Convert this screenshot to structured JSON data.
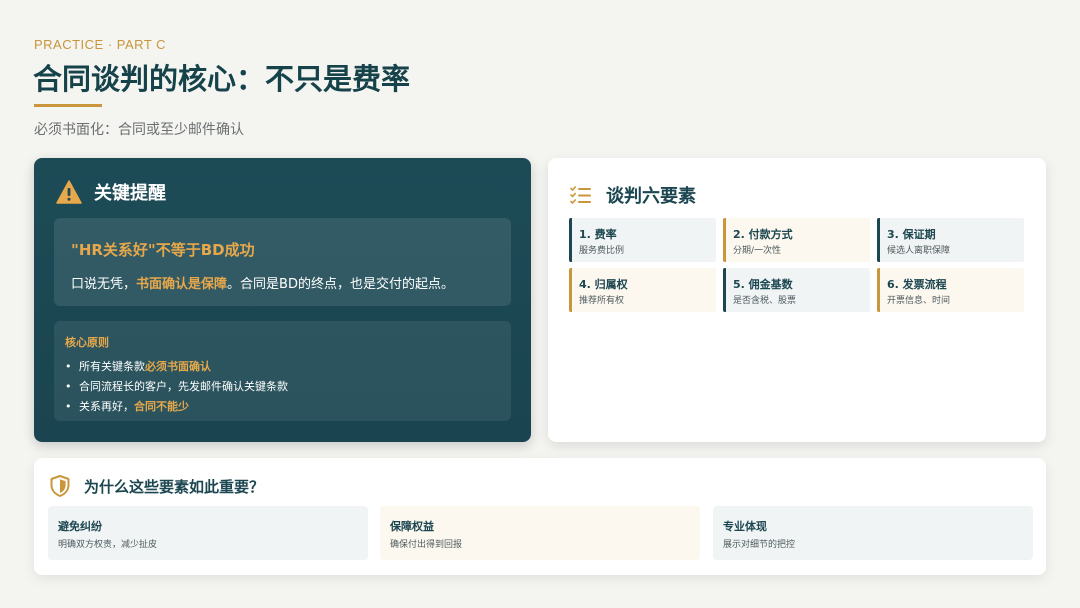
{
  "header": {
    "kicker": "PRACTICE · PART C",
    "title": "合同谈判的核心：不只是费率",
    "subtitle": "必须书面化：合同或至少邮件确认"
  },
  "reminder_card": {
    "icon": "warning-triangle-icon",
    "title": "关键提醒",
    "callout_title": "\"HR关系好\"不等于BD成功",
    "callout_text_pre": "口说无凭，",
    "callout_text_highlight": "书面确认是保障",
    "callout_text_post": "。合同是BD的终点，也是交付的起点。",
    "principles_title": "核心原则",
    "principles": [
      {
        "pre": "所有关键条款",
        "highlight": "必须书面确认"
      },
      {
        "pre": "合同流程长的客户，先发邮件确认关键条款",
        "highlight": ""
      },
      {
        "pre": "关系再好，",
        "highlight": "合同不能少"
      }
    ]
  },
  "elements_card": {
    "icon": "checklist-icon",
    "title": "谈判六要素",
    "items": [
      {
        "title": "1. 费率",
        "desc": "服务费比例"
      },
      {
        "title": "2. 付款方式",
        "desc": "分期/一次性"
      },
      {
        "title": "3. 保证期",
        "desc": "候选人离职保障"
      },
      {
        "title": "4. 归属权",
        "desc": "推荐所有权"
      },
      {
        "title": "5. 佣金基数",
        "desc": "是否含税、股票"
      },
      {
        "title": "6. 发票流程",
        "desc": "开票信息、时间"
      }
    ]
  },
  "why_card": {
    "icon": "shield-icon",
    "title": "为什么这些要素如此重要？",
    "items": [
      {
        "title": "避免纠纷",
        "desc": "明确双方权责，减少扯皮"
      },
      {
        "title": "保障权益",
        "desc": "确保付出得到回报"
      },
      {
        "title": "专业体现",
        "desc": "展示对细节的把控"
      }
    ]
  },
  "colors": {
    "accent_gold": "#c9963b",
    "highlight_orange": "#e6a84a",
    "dark_teal": "#1c4b56",
    "background": "#f4f4f1"
  }
}
